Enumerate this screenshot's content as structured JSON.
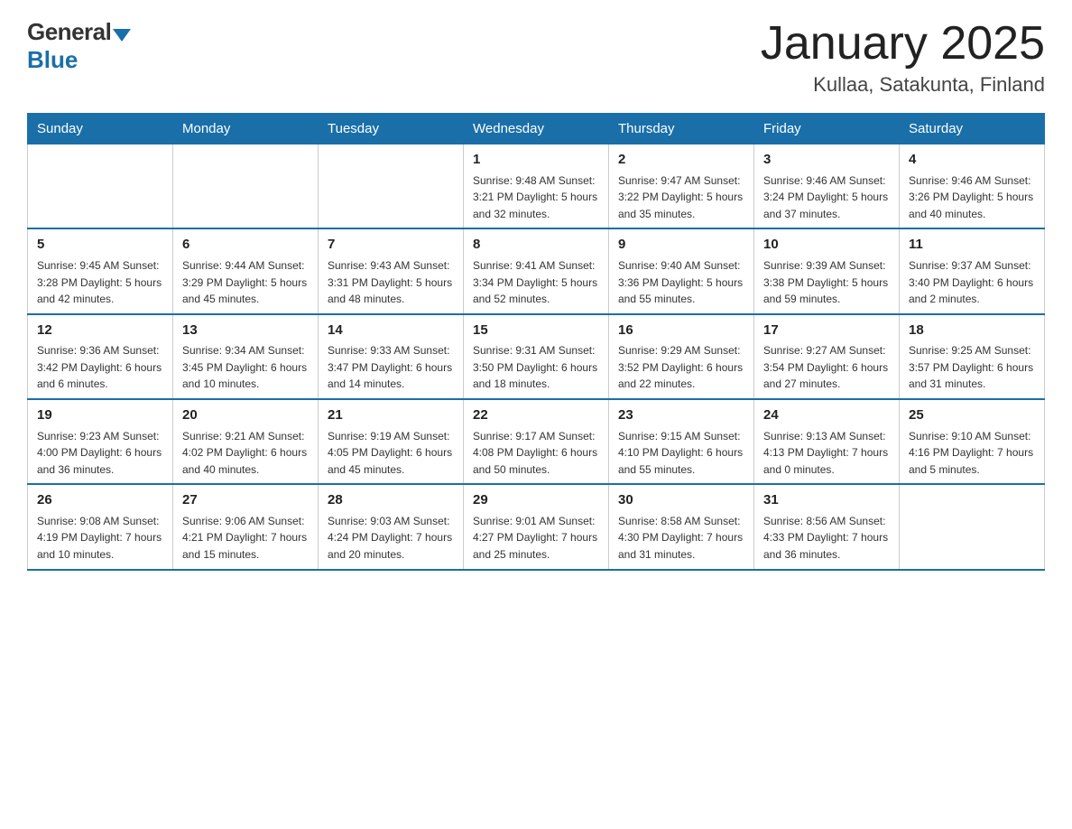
{
  "header": {
    "logo_general": "General",
    "logo_blue": "Blue",
    "month_title": "January 2025",
    "location": "Kullaa, Satakunta, Finland"
  },
  "days_of_week": [
    "Sunday",
    "Monday",
    "Tuesday",
    "Wednesday",
    "Thursday",
    "Friday",
    "Saturday"
  ],
  "weeks": [
    [
      {
        "day": "",
        "info": ""
      },
      {
        "day": "",
        "info": ""
      },
      {
        "day": "",
        "info": ""
      },
      {
        "day": "1",
        "info": "Sunrise: 9:48 AM\nSunset: 3:21 PM\nDaylight: 5 hours\nand 32 minutes."
      },
      {
        "day": "2",
        "info": "Sunrise: 9:47 AM\nSunset: 3:22 PM\nDaylight: 5 hours\nand 35 minutes."
      },
      {
        "day": "3",
        "info": "Sunrise: 9:46 AM\nSunset: 3:24 PM\nDaylight: 5 hours\nand 37 minutes."
      },
      {
        "day": "4",
        "info": "Sunrise: 9:46 AM\nSunset: 3:26 PM\nDaylight: 5 hours\nand 40 minutes."
      }
    ],
    [
      {
        "day": "5",
        "info": "Sunrise: 9:45 AM\nSunset: 3:28 PM\nDaylight: 5 hours\nand 42 minutes."
      },
      {
        "day": "6",
        "info": "Sunrise: 9:44 AM\nSunset: 3:29 PM\nDaylight: 5 hours\nand 45 minutes."
      },
      {
        "day": "7",
        "info": "Sunrise: 9:43 AM\nSunset: 3:31 PM\nDaylight: 5 hours\nand 48 minutes."
      },
      {
        "day": "8",
        "info": "Sunrise: 9:41 AM\nSunset: 3:34 PM\nDaylight: 5 hours\nand 52 minutes."
      },
      {
        "day": "9",
        "info": "Sunrise: 9:40 AM\nSunset: 3:36 PM\nDaylight: 5 hours\nand 55 minutes."
      },
      {
        "day": "10",
        "info": "Sunrise: 9:39 AM\nSunset: 3:38 PM\nDaylight: 5 hours\nand 59 minutes."
      },
      {
        "day": "11",
        "info": "Sunrise: 9:37 AM\nSunset: 3:40 PM\nDaylight: 6 hours\nand 2 minutes."
      }
    ],
    [
      {
        "day": "12",
        "info": "Sunrise: 9:36 AM\nSunset: 3:42 PM\nDaylight: 6 hours\nand 6 minutes."
      },
      {
        "day": "13",
        "info": "Sunrise: 9:34 AM\nSunset: 3:45 PM\nDaylight: 6 hours\nand 10 minutes."
      },
      {
        "day": "14",
        "info": "Sunrise: 9:33 AM\nSunset: 3:47 PM\nDaylight: 6 hours\nand 14 minutes."
      },
      {
        "day": "15",
        "info": "Sunrise: 9:31 AM\nSunset: 3:50 PM\nDaylight: 6 hours\nand 18 minutes."
      },
      {
        "day": "16",
        "info": "Sunrise: 9:29 AM\nSunset: 3:52 PM\nDaylight: 6 hours\nand 22 minutes."
      },
      {
        "day": "17",
        "info": "Sunrise: 9:27 AM\nSunset: 3:54 PM\nDaylight: 6 hours\nand 27 minutes."
      },
      {
        "day": "18",
        "info": "Sunrise: 9:25 AM\nSunset: 3:57 PM\nDaylight: 6 hours\nand 31 minutes."
      }
    ],
    [
      {
        "day": "19",
        "info": "Sunrise: 9:23 AM\nSunset: 4:00 PM\nDaylight: 6 hours\nand 36 minutes."
      },
      {
        "day": "20",
        "info": "Sunrise: 9:21 AM\nSunset: 4:02 PM\nDaylight: 6 hours\nand 40 minutes."
      },
      {
        "day": "21",
        "info": "Sunrise: 9:19 AM\nSunset: 4:05 PM\nDaylight: 6 hours\nand 45 minutes."
      },
      {
        "day": "22",
        "info": "Sunrise: 9:17 AM\nSunset: 4:08 PM\nDaylight: 6 hours\nand 50 minutes."
      },
      {
        "day": "23",
        "info": "Sunrise: 9:15 AM\nSunset: 4:10 PM\nDaylight: 6 hours\nand 55 minutes."
      },
      {
        "day": "24",
        "info": "Sunrise: 9:13 AM\nSunset: 4:13 PM\nDaylight: 7 hours\nand 0 minutes."
      },
      {
        "day": "25",
        "info": "Sunrise: 9:10 AM\nSunset: 4:16 PM\nDaylight: 7 hours\nand 5 minutes."
      }
    ],
    [
      {
        "day": "26",
        "info": "Sunrise: 9:08 AM\nSunset: 4:19 PM\nDaylight: 7 hours\nand 10 minutes."
      },
      {
        "day": "27",
        "info": "Sunrise: 9:06 AM\nSunset: 4:21 PM\nDaylight: 7 hours\nand 15 minutes."
      },
      {
        "day": "28",
        "info": "Sunrise: 9:03 AM\nSunset: 4:24 PM\nDaylight: 7 hours\nand 20 minutes."
      },
      {
        "day": "29",
        "info": "Sunrise: 9:01 AM\nSunset: 4:27 PM\nDaylight: 7 hours\nand 25 minutes."
      },
      {
        "day": "30",
        "info": "Sunrise: 8:58 AM\nSunset: 4:30 PM\nDaylight: 7 hours\nand 31 minutes."
      },
      {
        "day": "31",
        "info": "Sunrise: 8:56 AM\nSunset: 4:33 PM\nDaylight: 7 hours\nand 36 minutes."
      },
      {
        "day": "",
        "info": ""
      }
    ]
  ]
}
